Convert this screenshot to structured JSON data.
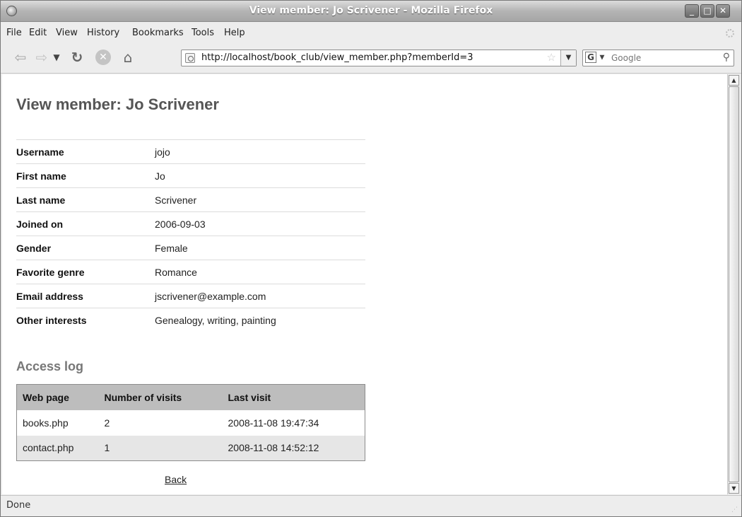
{
  "window": {
    "title": "View member: Jo Scrivener - Mozilla Firefox"
  },
  "menu": [
    "File",
    "Edit",
    "View",
    "History",
    "Bookmarks",
    "Tools",
    "Help"
  ],
  "address_bar": {
    "url": "http://localhost/book_club/view_member.php?memberId=3"
  },
  "search_bar": {
    "engine": "G",
    "placeholder": "Google"
  },
  "page": {
    "title": "View member: Jo Scrivener",
    "details": [
      {
        "label": "Username",
        "value": "jojo"
      },
      {
        "label": "First name",
        "value": "Jo"
      },
      {
        "label": "Last name",
        "value": "Scrivener"
      },
      {
        "label": "Joined on",
        "value": "2006-09-03"
      },
      {
        "label": "Gender",
        "value": "Female"
      },
      {
        "label": "Favorite genre",
        "value": "Romance"
      },
      {
        "label": "Email address",
        "value": "jscrivener@example.com"
      },
      {
        "label": "Other interests",
        "value": "Genealogy, writing, painting"
      }
    ],
    "access_log": {
      "title": "Access log",
      "headers": [
        "Web page",
        "Number of visits",
        "Last visit"
      ],
      "rows": [
        [
          "books.php",
          "2",
          "2008-11-08 19:47:34"
        ],
        [
          "contact.php",
          "1",
          "2008-11-08 14:52:12"
        ]
      ]
    },
    "back_link": "Back"
  },
  "status": {
    "text": "Done"
  }
}
